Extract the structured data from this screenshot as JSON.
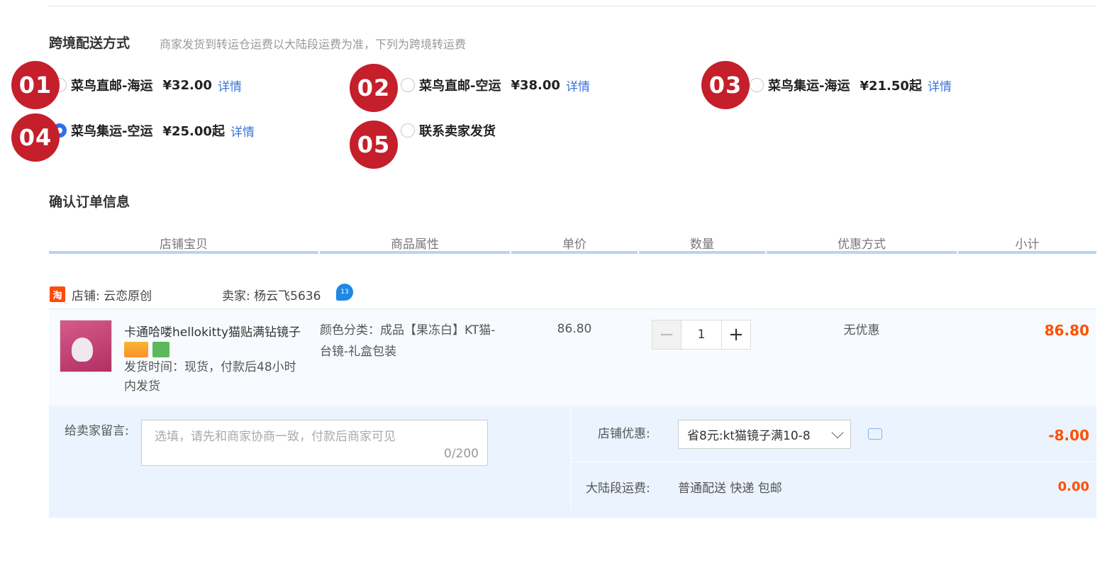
{
  "shipping": {
    "title": "跨境配送方式",
    "hint": "商家发货到转运仓运费以大陆段运费为准，下列为跨境转运费",
    "options": [
      {
        "badge": "01",
        "name": "菜鸟直邮-海运",
        "price": "¥32.00",
        "link": "详情",
        "selected": false
      },
      {
        "badge": "02",
        "name": "菜鸟直邮-空运",
        "price": "¥38.00",
        "link": "详情",
        "selected": false
      },
      {
        "badge": "03",
        "name": "菜鸟集运-海运",
        "price": "¥21.50起",
        "link": "详情",
        "selected": false
      },
      {
        "badge": "04",
        "name": "菜鸟集运-空运",
        "price": "¥25.00起",
        "link": "详情",
        "selected": true
      },
      {
        "badge": "05",
        "name": "联系卖家发货",
        "price": "",
        "link": "",
        "selected": false
      }
    ]
  },
  "order": {
    "title": "确认订单信息",
    "columns": [
      "店铺宝贝",
      "商品属性",
      "单价",
      "数量",
      "优惠方式",
      "小计"
    ],
    "shop": {
      "icon": "淘",
      "shop_label": "店铺: 云恋原创",
      "seller_label": "卖家: 杨云飞5636",
      "ww_icon_text": "13"
    },
    "item": {
      "title": "卡通哈喽hellokitty猫贴满钻镜子",
      "delivery": "发货时间：现货，付款后48小时",
      "delivery2": "内发货",
      "attr_line1": "颜色分类：成品【果冻白】KT猫-",
      "attr_line2": "台镜-礼盒包装",
      "unit_price": "86.80",
      "qty_minus": "−",
      "qty": "1",
      "qty_plus": "+",
      "discount": "无优惠",
      "subtotal": "86.80"
    },
    "message": {
      "label": "给卖家留言:",
      "placeholder": "选填，请先和商家协商一致，付款后商家可见",
      "counter": "0/200"
    },
    "shop_discount": {
      "label": "店铺优惠:",
      "selected": "省8元:kt猫镜子满10-8",
      "value": "-8.00"
    },
    "mainland_shipping": {
      "label": "大陆段运费:",
      "text": "普通配送 快递 包邮",
      "value": "0.00"
    }
  },
  "colors": {
    "badge": "#c41f2b",
    "accent_orange": "#ff5000",
    "link_blue": "#3b73d9",
    "radio_blue": "#2f6ee8",
    "header_line": "#b9d3f7"
  }
}
